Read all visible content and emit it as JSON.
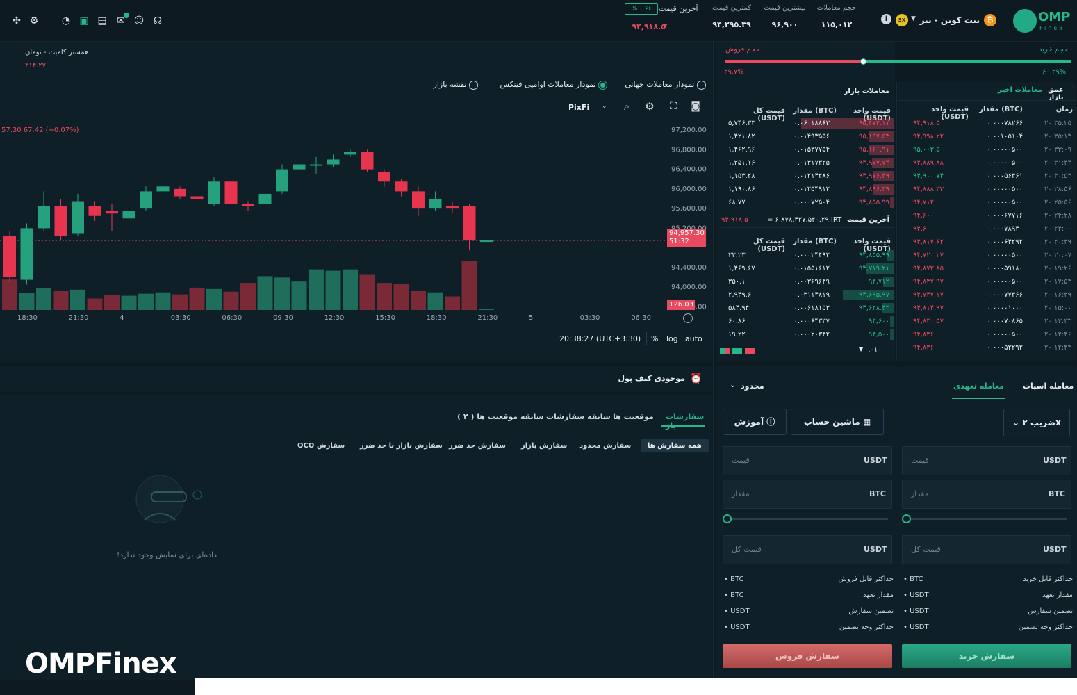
{
  "header": {
    "brand": "OMP",
    "brand_sub": "Finex",
    "pair": "بیت کوین - تتر",
    "sx_badge": "SX",
    "stats": [
      {
        "label": "حجم معاملات",
        "value": "۱۱۵,۰۱۲"
      },
      {
        "label": "بیشترین قیمت",
        "value": "۹۶,۹۰۰"
      },
      {
        "label": "کمترین قیمت",
        "value": "۹۴,۲۹۵.۳۹"
      },
      {
        "label": "آخرین قیمت",
        "value": "۹۴,۹۱۸.۵"
      }
    ],
    "change_badge": "% ۰.۶۶"
  },
  "chart": {
    "comparison_label": "همستر کامبت - تومان",
    "comparison_value": "۳۱۴.۲۷",
    "options": [
      "نمودار معاملات جهانی",
      "نمودار معاملات اوامپی فینکس",
      "نقشه بازار"
    ],
    "selected_option": 1,
    "source": "PixFi",
    "ohlc_readout": "57.30 67.42 (+0.07%)",
    "price_tag": "94,957.30",
    "price_tag_timer": "51:32",
    "volume_tag": "126.03",
    "time_readout": "20:38:27 (UTC+3:30)",
    "scale_opts": [
      "%",
      "log",
      "auto"
    ]
  },
  "chart_data": {
    "type": "candlestick",
    "y_ticks": [
      "97,200.00",
      "96,800.00",
      "96,400.00",
      "96,000.00",
      "95,600.00",
      "95,200.00",
      "94,800.00",
      "94,400.00",
      "94,000.00",
      "93,600.00"
    ],
    "x_ticks": [
      "18:30",
      "21:30",
      "4",
      "03:30",
      "06:30",
      "09:30",
      "12:30",
      "15:30",
      "18:30",
      "21:30",
      "5",
      "03:30",
      "06:30"
    ],
    "ylim": [
      93550,
      97300
    ],
    "candles": [
      {
        "o": 95050,
        "c": 94200,
        "h": 95150,
        "l": 94100
      },
      {
        "o": 94150,
        "c": 95200,
        "h": 95300,
        "l": 94050
      },
      {
        "o": 95200,
        "c": 95650,
        "h": 95950,
        "l": 95150
      },
      {
        "o": 95650,
        "c": 95050,
        "h": 95800,
        "l": 94950
      },
      {
        "o": 95100,
        "c": 95750,
        "h": 95900,
        "l": 95050
      },
      {
        "o": 95650,
        "c": 95450,
        "h": 95750,
        "l": 95350
      },
      {
        "o": 95550,
        "c": 95500,
        "h": 95700,
        "l": 95150
      },
      {
        "o": 95400,
        "c": 95550,
        "h": 95650,
        "l": 95350
      },
      {
        "o": 95600,
        "c": 95950,
        "h": 96050,
        "l": 95550
      },
      {
        "o": 95950,
        "c": 96050,
        "h": 96150,
        "l": 95850
      },
      {
        "o": 96000,
        "c": 95850,
        "h": 96050,
        "l": 95800
      },
      {
        "o": 95850,
        "c": 95800,
        "h": 95950,
        "l": 95700
      },
      {
        "o": 95700,
        "c": 96150,
        "h": 96250,
        "l": 95650
      },
      {
        "o": 96150,
        "c": 95700,
        "h": 96200,
        "l": 95650
      },
      {
        "o": 95700,
        "c": 95650,
        "h": 95750,
        "l": 95550
      },
      {
        "o": 95700,
        "c": 95900,
        "h": 95950,
        "l": 95650
      },
      {
        "o": 95950,
        "c": 96400,
        "h": 96500,
        "l": 95900
      },
      {
        "o": 96400,
        "c": 96500,
        "h": 96650,
        "l": 96300
      },
      {
        "o": 96500,
        "c": 96500,
        "h": 96650,
        "l": 96300
      },
      {
        "o": 96500,
        "c": 96600,
        "h": 96700,
        "l": 96450
      },
      {
        "o": 96700,
        "c": 96750,
        "h": 96800,
        "l": 96650
      },
      {
        "o": 96750,
        "c": 96400,
        "h": 96800,
        "l": 96350
      },
      {
        "o": 96350,
        "c": 96150,
        "h": 96400,
        "l": 96050
      },
      {
        "o": 96150,
        "c": 95950,
        "h": 96200,
        "l": 95850
      },
      {
        "o": 95950,
        "c": 95600,
        "h": 96050,
        "l": 95450
      },
      {
        "o": 95600,
        "c": 95800,
        "h": 95950,
        "l": 95550
      },
      {
        "o": 95650,
        "c": 95600,
        "h": 95750,
        "l": 95500
      },
      {
        "o": 95650,
        "c": 94950,
        "h": 95700,
        "l": 94750
      },
      {
        "o": 94950,
        "c": 94950,
        "h": 94950,
        "l": 94950
      }
    ],
    "volumes": [
      45,
      25,
      32,
      28,
      30,
      17,
      22,
      21,
      24,
      26,
      23,
      33,
      31,
      27,
      40,
      50,
      48,
      42,
      60,
      58,
      60,
      53,
      40,
      38,
      28,
      26,
      20,
      72,
      2
    ]
  },
  "orderbook": {
    "title": "معاملات بازار",
    "volume_buy_label": "حجم خرید",
    "volume_sell_label": "حجم فروش",
    "volume_buy_pct": "۶۰.۲۹%",
    "volume_sell_pct": "۳۹.۷%",
    "buy_pct_value": 60.29,
    "cols": [
      "قیمت واحد (USDT)",
      "مقدار (BTC)",
      "قیمت کل (USDT)"
    ],
    "asks": [
      {
        "p": "۹۵,۴۷۲.۱۱",
        "a": "۰.۰۶۰۱۸۸۶۳",
        "t": "۵,۷۴۶.۳۳",
        "d": 0.55
      },
      {
        "p": "۹۵,۱۹۷.۵۳",
        "a": "۰.۰۱۴۹۳۵۵۶",
        "t": "۱,۴۲۱.۸۲",
        "d": 0.15
      },
      {
        "p": "۹۵,۱۶۰.۹۱",
        "a": "۰.۰۱۵۳۷۷۵۴",
        "t": "۱,۴۶۲.۹۶",
        "d": 0.15
      },
      {
        "p": "۹۴,۹۷۷.۷۴",
        "a": "۰.۰۱۳۱۷۳۲۵",
        "t": "۱,۲۵۱.۱۶",
        "d": 0.13
      },
      {
        "p": "۹۴,۹۷۶.۴۹",
        "a": "۰.۰۱۲۱۴۲۸۶",
        "t": "۱,۱۵۳.۲۸",
        "d": 0.12
      },
      {
        "p": "۹۴,۸۹۶.۳۹",
        "a": "۰.۰۱۲۵۴۹۱۲",
        "t": "۱,۱۹۰.۸۶",
        "d": 0.12
      },
      {
        "p": "۹۴,۸۵۵.۹۹",
        "a": "۰.۰۰۰۷۲۵۰۴",
        "t": "۶۸.۷۷",
        "d": 0.02
      }
    ],
    "last_price_label": "آخرین قیمت",
    "last_price": "۹۴,۹۱۸.۵",
    "last_price_irt": "= ۶,۸۷۸,۴۲۷,۵۲۰.۲۹ IRT",
    "bids": [
      {
        "p": "۹۴,۸۵۵.۹۹",
        "a": "۰.۰۰۰۲۴۴۹۲",
        "t": "۲۳.۲۳",
        "d": 0.04
      },
      {
        "p": "۹۴,۷۱۹.۲۱",
        "a": "۰.۰۱۵۵۱۶۱۲",
        "t": "۱,۴۶۹.۶۷",
        "d": 0.16
      },
      {
        "p": "۹۴,۷۱۲",
        "a": "۰.۰۰۳۶۹۶۴۹",
        "t": "۳۵۰.۱",
        "d": 0.06
      },
      {
        "p": "۹۴,۶۹۵.۹۷",
        "a": "۰.۰۳۱۱۴۸۱۹",
        "t": "۲,۹۴۹.۶",
        "d": 0.3
      },
      {
        "p": "۹۴,۶۲۸.۴۲",
        "a": "۰.۰۰۶۱۸۱۵۳",
        "t": "۵۸۴.۹۴",
        "d": 0.07
      },
      {
        "p": "۹۴,۶۰۰",
        "a": "۰.۰۰۰۶۴۳۳۷",
        "t": "۶۰.۸۶",
        "d": 0.02
      },
      {
        "p": "۹۴,۵۰۰",
        "a": "۰.۰۰۰۲۰۳۴۲",
        "t": "۱۹.۲۲",
        "d": 0.02
      }
    ],
    "precision": "۰.۰۱"
  },
  "recent": {
    "tabs": [
      "عمق بازار",
      "معاملات اخیر"
    ],
    "cols": [
      "زمان",
      "مقدار (BTC)",
      "قیمت واحد (USDT)"
    ],
    "rows": [
      {
        "time": "۲۰:۳۵:۲۵",
        "amt": "۰.۰۰۰۷۸۲۶۶",
        "price": "۹۴,۹۱۸.۵"
      },
      {
        "time": "۲۰:۳۵:۱۳",
        "amt": "۰.۰۰۱۰۵۱۰۴",
        "price": "۹۴,۹۹۸.۲۲"
      },
      {
        "time": "۲۰:۳۳:۰۹",
        "amt": "۰.۰۰۰۰۰۵۰۰",
        "price": "۹۵,۰۰۳.۵"
      },
      {
        "time": "۲۰:۳۱:۴۴",
        "amt": "۰.۰۰۰۰۰۵۰۰",
        "price": "۹۴,۸۸۹.۸۸"
      },
      {
        "time": "۲۰:۳۰:۵۳",
        "amt": "۰.۰۰۰۵۶۴۶۱",
        "price": "۹۴,۹۰۰.۷۴"
      },
      {
        "time": "۲۰:۲۸:۵۶",
        "amt": "۰.۰۰۰۰۰۵۰۰",
        "price": "۹۴,۸۸۸.۳۳"
      },
      {
        "time": "۲۰:۲۵:۵۶",
        "amt": "۰.۰۰۰۰۰۵۰۰",
        "price": "۹۴,۷۱۲"
      },
      {
        "time": "۲۰:۲۴:۲۸",
        "amt": "۰.۰۰۰۶۷۷۱۶",
        "price": "۹۴,۶۰۰"
      },
      {
        "time": "۲۰:۲۴:۰۰",
        "amt": "۰.۰۰۰۷۸۹۴۰",
        "price": "۹۴,۶۰۰"
      },
      {
        "time": "۲۰:۲۰:۳۹",
        "amt": "۰.۰۰۰۶۴۲۹۲",
        "price": "۹۴,۸۱۷.۶۲"
      },
      {
        "time": "۲۰:۲۰:۰۷",
        "amt": "۰.۰۰۰۰۰۵۰۰",
        "price": "۹۴,۷۲۰.۲۷"
      },
      {
        "time": "۲۰:۱۹:۲۶",
        "amt": "۰.۰۰۰۵۹۱۸۰",
        "price": "۹۴,۸۷۲.۸۵"
      },
      {
        "time": "۲۰:۱۷:۵۳",
        "amt": "۰.۰۰۰۰۰۵۰۰",
        "price": "۹۴,۸۴۷.۹۷"
      },
      {
        "time": "۲۰:۱۶:۳۹",
        "amt": "۰.۰۰۰۷۷۳۶۶",
        "price": "۹۴,۷۴۷.۱۷"
      },
      {
        "time": "۲۰:۱۵:۰۰",
        "amt": "۰.۰۰۰۰۱۰۰۰",
        "price": "۹۴,۸۱۴.۹۷"
      },
      {
        "time": "۲۰:۱۳:۳۳",
        "amt": "۰.۰۰۰۷۰۸۶۵",
        "price": "۹۴,۸۳۰.۵۷"
      },
      {
        "time": "۲۰:۱۲:۴۶",
        "amt": "۰.۰۰۰۰۰۵۰۰",
        "price": "۹۴,۸۳۶"
      },
      {
        "time": "۲۰:۱۲:۴۳",
        "amt": "۰.۰۰۰۵۲۲۹۲",
        "price": "۹۴,۸۳۶"
      }
    ]
  },
  "trade": {
    "tabs": [
      "معامله اسپات",
      "معامله تعهدی"
    ],
    "order_type": "محدود",
    "leverage": "ضریب ۲x",
    "calculator": "ماشین حساب",
    "tutorial": "آموزش",
    "price_ph": "قیمت",
    "amount_ph": "مقدار",
    "total_ph": "قیمت کل",
    "usdt": "USDT",
    "btc": "BTC",
    "buy_info": [
      "حداکثر قابل خرید",
      "مقدار تعهد",
      "تضمین سفارش",
      "حداکثر وجه تضمین"
    ],
    "sell_info": [
      "حداکثر قابل فروش",
      "مقدار تعهد",
      "تضمین سفارش",
      "حداکثر وجه تضمین"
    ],
    "buy_cur": [
      "BTC",
      "USDT",
      "USDT",
      "USDT"
    ],
    "sell_cur": [
      "BTC",
      "BTC",
      "USDT",
      "USDT"
    ],
    "buy_btn": "سفارش خرید",
    "sell_btn": "سفارش فروش"
  },
  "orders": {
    "wallet_label": "موجودی کیف پول",
    "tabs": [
      "سفارشات باز",
      "موقعیت ها",
      "سابقه سفارشات",
      "سابقه موقعیت ها ( ۲ )"
    ],
    "chips": [
      "همه سفارش ها",
      "سفارش محدود",
      "سفارش بازار",
      "سفارش حد ضرر",
      "سفارش بازار با حد ضرر",
      "سفارش OCO"
    ],
    "empty": "داده‌ای برای نمایش وجود ندارد!"
  },
  "footer_brand": "OMPFinex",
  "colors": {
    "green": "#26b88a",
    "red": "#e84a5f",
    "bg": "#0f1f28"
  }
}
